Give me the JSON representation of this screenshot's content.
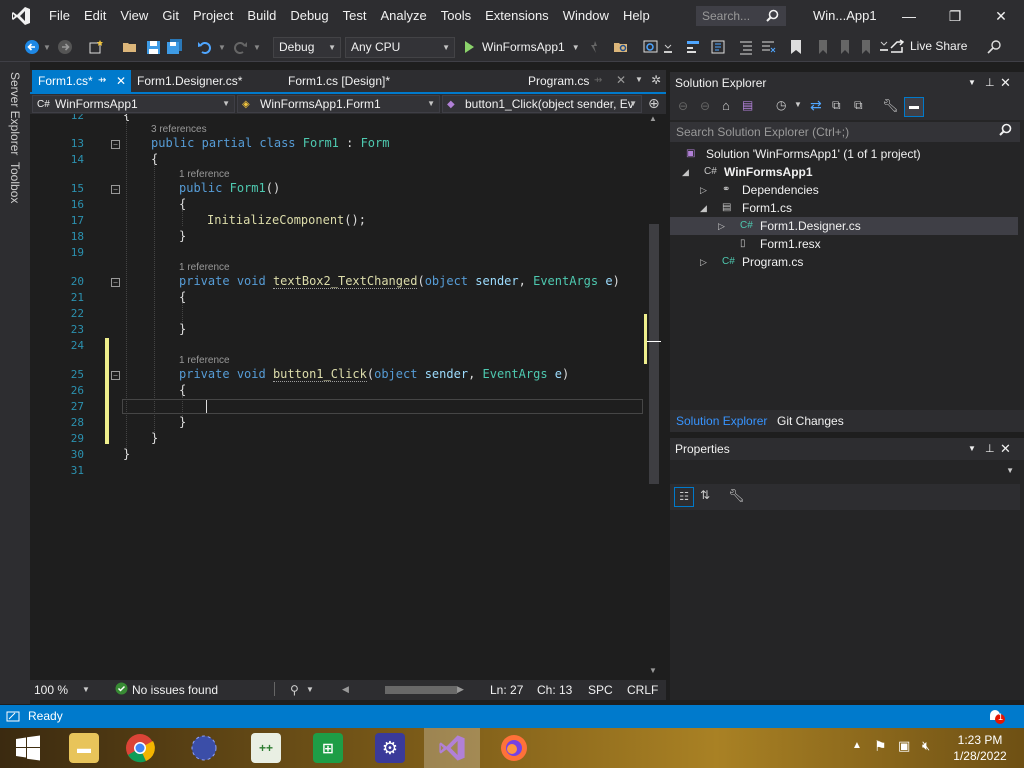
{
  "window": {
    "title": "Win...App1",
    "search_placeholder": "Search...",
    "menu": [
      "File",
      "Edit",
      "View",
      "Git",
      "Project",
      "Build",
      "Debug",
      "Test",
      "Analyze",
      "Tools",
      "Extensions",
      "Window",
      "Help"
    ],
    "minimize": "—",
    "maximize": "❐",
    "close": "✕"
  },
  "toolbar": {
    "config": "Debug",
    "platform": "Any CPU",
    "run_target": "WinFormsApp1",
    "live_share": "Live Share"
  },
  "left_strip": {
    "server_explorer": "Server Explorer",
    "toolbox": "Toolbox"
  },
  "doc_tabs": [
    {
      "label": "Form1.cs*"
    },
    {
      "label": "Form1.Designer.cs*"
    },
    {
      "label": "Form1.cs [Design]*"
    },
    {
      "label": "Program.cs"
    }
  ],
  "navbar": {
    "project": "WinFormsApp1",
    "class": "WinFormsApp1.Form1",
    "member": "button1_Click(object sender, Ev"
  },
  "editor": {
    "line_numbers": [
      "12",
      "13",
      "14",
      "15",
      "16",
      "17",
      "18",
      "19",
      "20",
      "21",
      "22",
      "23",
      "24",
      "25",
      "26",
      "27",
      "28",
      "29",
      "30",
      "31"
    ],
    "codelens": {
      "class_refs": "3 references",
      "ctor_refs": "1 reference",
      "tb_refs": "1 reference",
      "btn_refs": "1 reference"
    },
    "code": {
      "public": "public",
      "partial": "partial",
      "class": "class",
      "form1": "Form1",
      "colon": " : ",
      "form": "Form",
      "lbrace": "{",
      "rbrace": "}",
      "ctor_name": "Form1",
      "parens": "()",
      "init": "InitializeComponent",
      "init_tail": "();",
      "private": "private",
      "void": "void",
      "tb_handler": "textBox2_TextChanged",
      "btn_handler": "button1_Click",
      "lparen": "(",
      "object": "object",
      "sender": "sender",
      "comma": ", ",
      "eventargs": "EventArgs",
      "e": "e",
      "rparen": ")"
    }
  },
  "edit_status": {
    "zoom": "100 %",
    "issues": "No issues found",
    "line": "Ln: 27",
    "col": "Ch: 13",
    "spc": "SPC",
    "eol": "CRLF"
  },
  "solution_explorer": {
    "title": "Solution Explorer",
    "search_placeholder": "Search Solution Explorer (Ctrl+;)",
    "tree": {
      "solution": "Solution 'WinFormsApp1' (1 of 1 project)",
      "project": "WinFormsApp1",
      "dependencies": "Dependencies",
      "form1cs": "Form1.cs",
      "designer": "Form1.Designer.cs",
      "resx": "Form1.resx",
      "program": "Program.cs"
    },
    "tab_se": "Solution Explorer",
    "tab_git": "Git Changes"
  },
  "properties": {
    "title": "Properties"
  },
  "statusbar": {
    "ready": "Ready",
    "notif_count": "1"
  },
  "taskbar": {
    "time": "1:23 PM",
    "date": "1/28/2022"
  }
}
